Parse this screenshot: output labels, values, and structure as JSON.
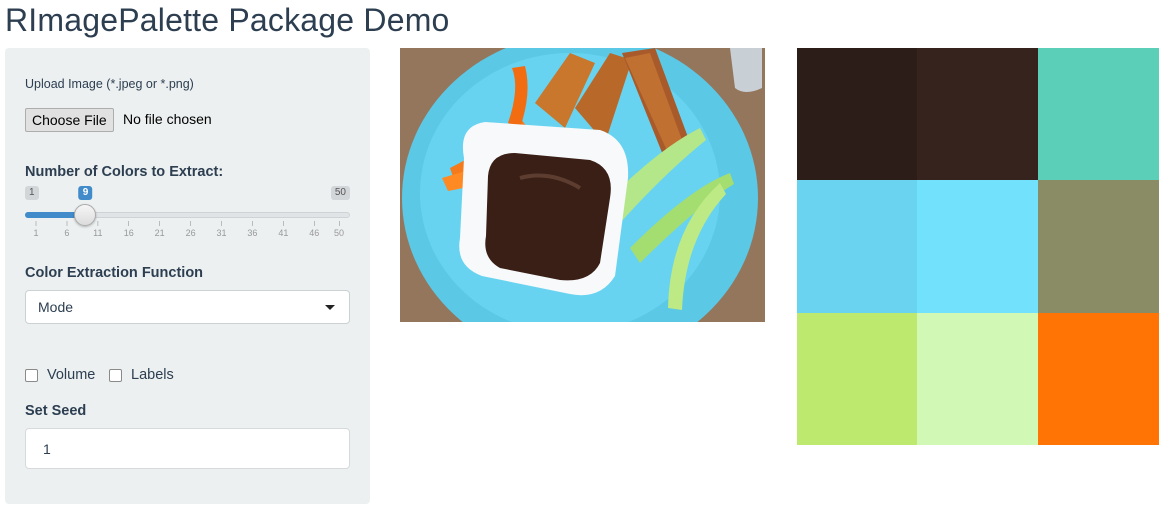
{
  "app": {
    "title": "RImagePalette Package Demo"
  },
  "sidebar": {
    "upload_label": "Upload Image (*.jpeg or *.png)",
    "choose_file_label": "Choose File",
    "file_status": "No file chosen",
    "colors_label": "Number of Colors to Extract:",
    "slider": {
      "min": 1,
      "max": 50,
      "value": 9,
      "min_label": "1",
      "max_label": "50",
      "value_label": "9",
      "ticks": [
        "1",
        "6",
        "11",
        "16",
        "21",
        "26",
        "31",
        "36",
        "41",
        "46",
        "50"
      ]
    },
    "function_label": "Color Extraction Function",
    "function_selected": "Mode",
    "volume_label": "Volume",
    "labels_label": "Labels",
    "seed_label": "Set Seed",
    "seed_value": "1"
  },
  "palette": {
    "colors": [
      "#2d1d19",
      "#37231e",
      "#5ccfb9",
      "#6ad3ef",
      "#72e1fb",
      "#8a8c66",
      "#bdea6e",
      "#d1f8b5",
      "#ff7404"
    ]
  }
}
